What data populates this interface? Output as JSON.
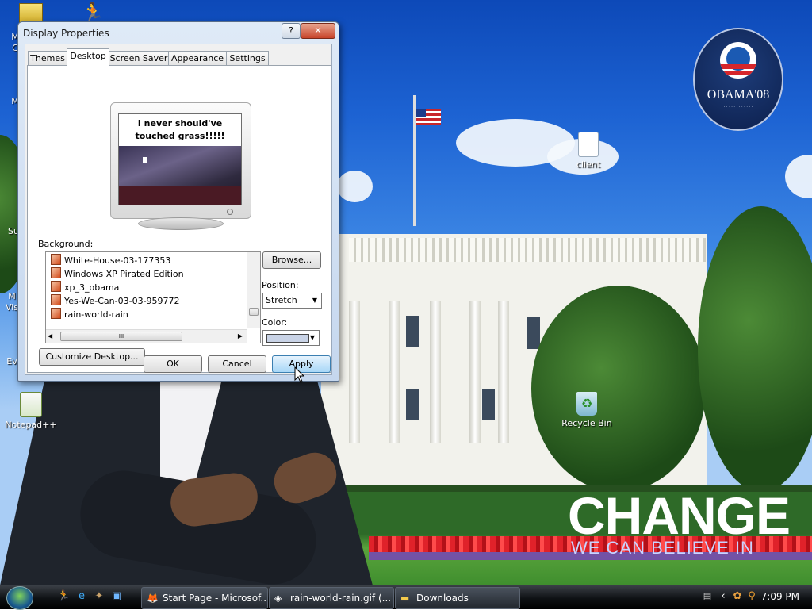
{
  "desktop": {
    "icons": [
      {
        "label": "client",
        "icon": "document-icon"
      },
      {
        "label": "Recycle Bin",
        "icon": "recycle-bin-icon"
      },
      {
        "label": "Notepad++",
        "icon": "notepad-plus-plus-icon"
      }
    ],
    "partial_labels": [
      "M",
      "C",
      "M",
      "Su",
      "M",
      "Vis",
      "Ev"
    ],
    "wallpaper": {
      "slogan": "CHANGE",
      "slogan_sub": "WE CAN BELIEVE IN",
      "logo_text": "OBAMA'08"
    }
  },
  "dialog": {
    "title": "Display Properties",
    "help_button": "?",
    "close_button": "✕",
    "tabs": [
      {
        "label": "Themes",
        "active": false
      },
      {
        "label": "Desktop",
        "active": true
      },
      {
        "label": "Screen Saver",
        "active": false
      },
      {
        "label": "Appearance",
        "active": false
      },
      {
        "label": "Settings",
        "active": false
      }
    ],
    "preview_caption": "I never should've touched grass!!!!!",
    "background_label": "Background:",
    "background_items": [
      "White-House-03-177353",
      "Windows XP Pirated Edition",
      "xp_3_obama",
      "Yes-We-Can-03-03-959772",
      "rain-world-rain"
    ],
    "browse_button": "Browse...",
    "position_label": "Position:",
    "position_value": "Stretch",
    "color_label": "Color:",
    "color_value": "#c9d3e6",
    "customize_button": "Customize Desktop...",
    "ok_button": "OK",
    "cancel_button": "Cancel",
    "apply_button": "Apply",
    "hscroll_grip": "III"
  },
  "taskbar": {
    "start_icon": "windows-orb-icon",
    "quick_launch": [
      "aim-icon",
      "internet-explorer-icon",
      "gimp-icon",
      "media-icon"
    ],
    "buttons": [
      {
        "label": "Start Page - Microsof...",
        "icon": "browser-icon"
      },
      {
        "label": "rain-world-rain.gif (...",
        "icon": "image-viewer-icon"
      },
      {
        "label": "Downloads",
        "icon": "folder-icon"
      }
    ],
    "tray_icons": [
      "keyboard-icon",
      "chevron-left-icon",
      "network-icon",
      "search-icon"
    ],
    "clock": "7:09 PM"
  }
}
